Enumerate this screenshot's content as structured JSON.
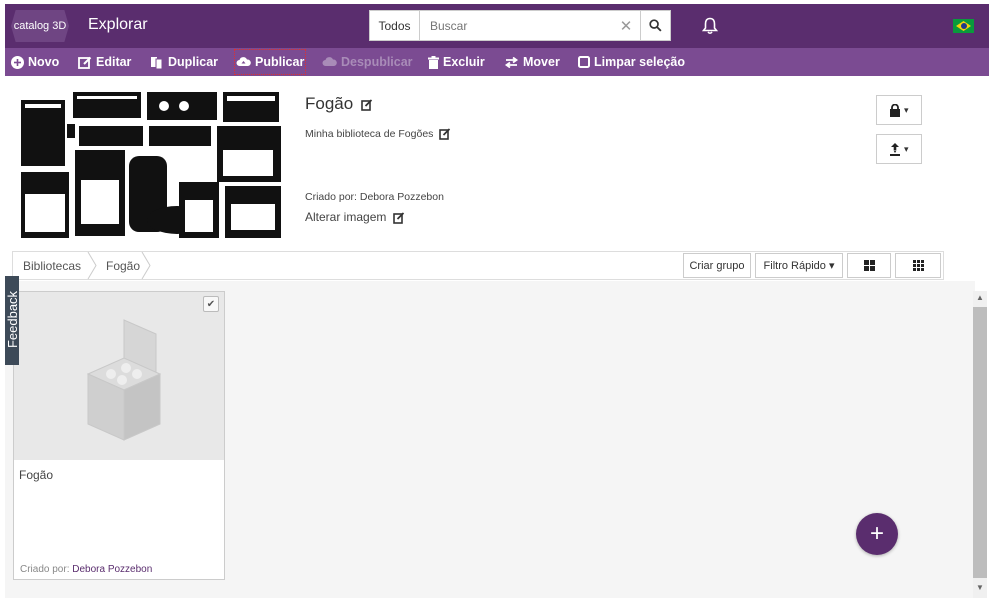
{
  "app": {
    "logo_text": "catalog 3D",
    "title": "Explorar"
  },
  "search": {
    "scope": "Todos",
    "placeholder": "Buscar",
    "clear_icon": "close-icon",
    "search_icon": "search-icon"
  },
  "header_icons": {
    "bell": "bell-icon",
    "flag": "flag-brazil"
  },
  "toolbar": {
    "novo": "Novo",
    "editar": "Editar",
    "duplicar": "Duplicar",
    "publicar": "Publicar",
    "despublicar": "Despublicar",
    "excluir": "Excluir",
    "mover": "Mover",
    "limpar": "Limpar seleção"
  },
  "library": {
    "title": "Fogão",
    "description": "Minha biblioteca de Fogões",
    "created_by_label": "Criado por:",
    "created_by": "Debora Pozzebon",
    "change_image": "Alterar imagem"
  },
  "breadcrumb": [
    "Bibliotecas",
    "Fogão"
  ],
  "actions": {
    "create_group": "Criar grupo",
    "quick_filter": "Filtro Rápido"
  },
  "items": [
    {
      "title": "Fogão",
      "created_by_label": "Criado por:",
      "created_by": "Debora Pozzebon"
    }
  ],
  "feedback": "Feedback",
  "colors": {
    "brand_dark": "#5a2d6e",
    "brand_toolbar": "#7b4b92",
    "disabled": "#a98cb8"
  }
}
